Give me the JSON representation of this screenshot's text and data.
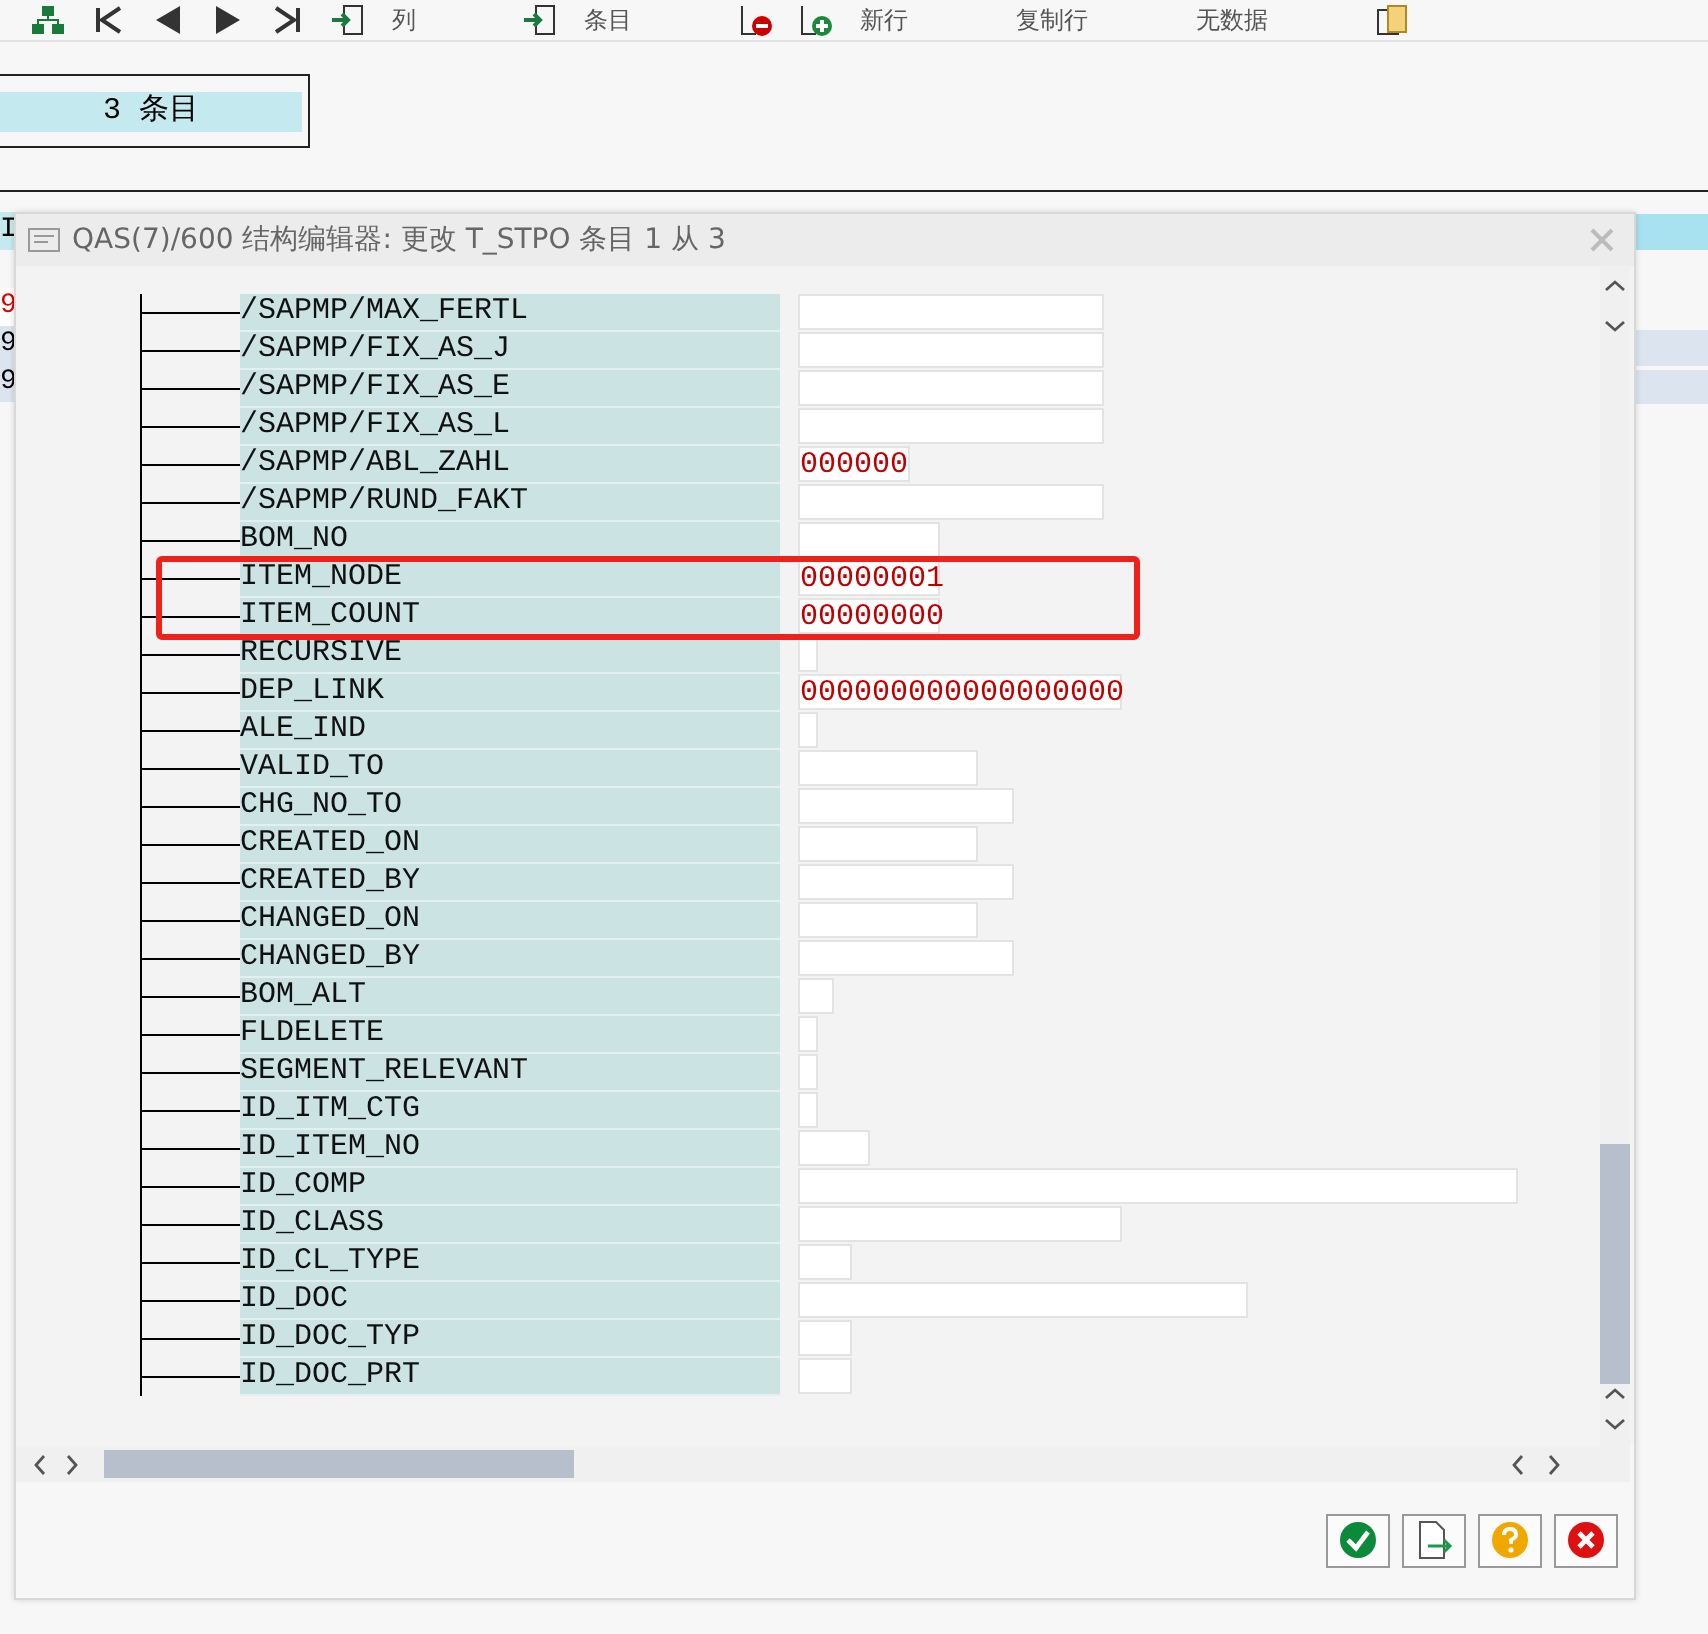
{
  "toolbar": {
    "labels": [
      "列",
      "条目",
      "新行",
      "复制行",
      "无数据"
    ]
  },
  "summary": {
    "count": "3 条目"
  },
  "background_table": {
    "header": "I",
    "rows": [
      {
        "text": "9",
        "kind": "error"
      },
      {
        "text": "9",
        "kind": "normal"
      },
      {
        "text": "9",
        "kind": "normal"
      }
    ]
  },
  "dialog": {
    "title": "QAS(7)/600 结构编辑器: 更改 T_STPO 条目 1 从 3",
    "fields": [
      {
        "name": "/SAPMP/MAX_FERTL"
      },
      {
        "name": "/SAPMP/FIX_AS_J"
      },
      {
        "name": "/SAPMP/FIX_AS_E"
      },
      {
        "name": "/SAPMP/FIX_AS_L"
      },
      {
        "name": "/SAPMP/ABL_ZAHL",
        "value": "000000"
      },
      {
        "name": "/SAPMP/RUND_FAKT"
      },
      {
        "name": "BOM_NO"
      },
      {
        "name": "ITEM_NODE",
        "value": "00000001"
      },
      {
        "name": "ITEM_COUNT",
        "value": "00000000"
      },
      {
        "name": "RECURSIVE"
      },
      {
        "name": "DEP_LINK",
        "value": "000000000000000000"
      },
      {
        "name": "ALE_IND"
      },
      {
        "name": "VALID_TO"
      },
      {
        "name": "CHG_NO_TO"
      },
      {
        "name": "CREATED_ON"
      },
      {
        "name": "CREATED_BY"
      },
      {
        "name": "CHANGED_ON"
      },
      {
        "name": "CHANGED_BY"
      },
      {
        "name": "BOM_ALT"
      },
      {
        "name": "FLDELETE"
      },
      {
        "name": "SEGMENT_RELEVANT"
      },
      {
        "name": "ID_ITM_CTG"
      },
      {
        "name": "ID_ITEM_NO"
      },
      {
        "name": "ID_COMP"
      },
      {
        "name": "ID_CLASS"
      },
      {
        "name": "ID_CL_TYPE"
      },
      {
        "name": "ID_DOC"
      },
      {
        "name": "ID_DOC_TYP"
      },
      {
        "name": "ID_DOC_PRT"
      }
    ]
  }
}
